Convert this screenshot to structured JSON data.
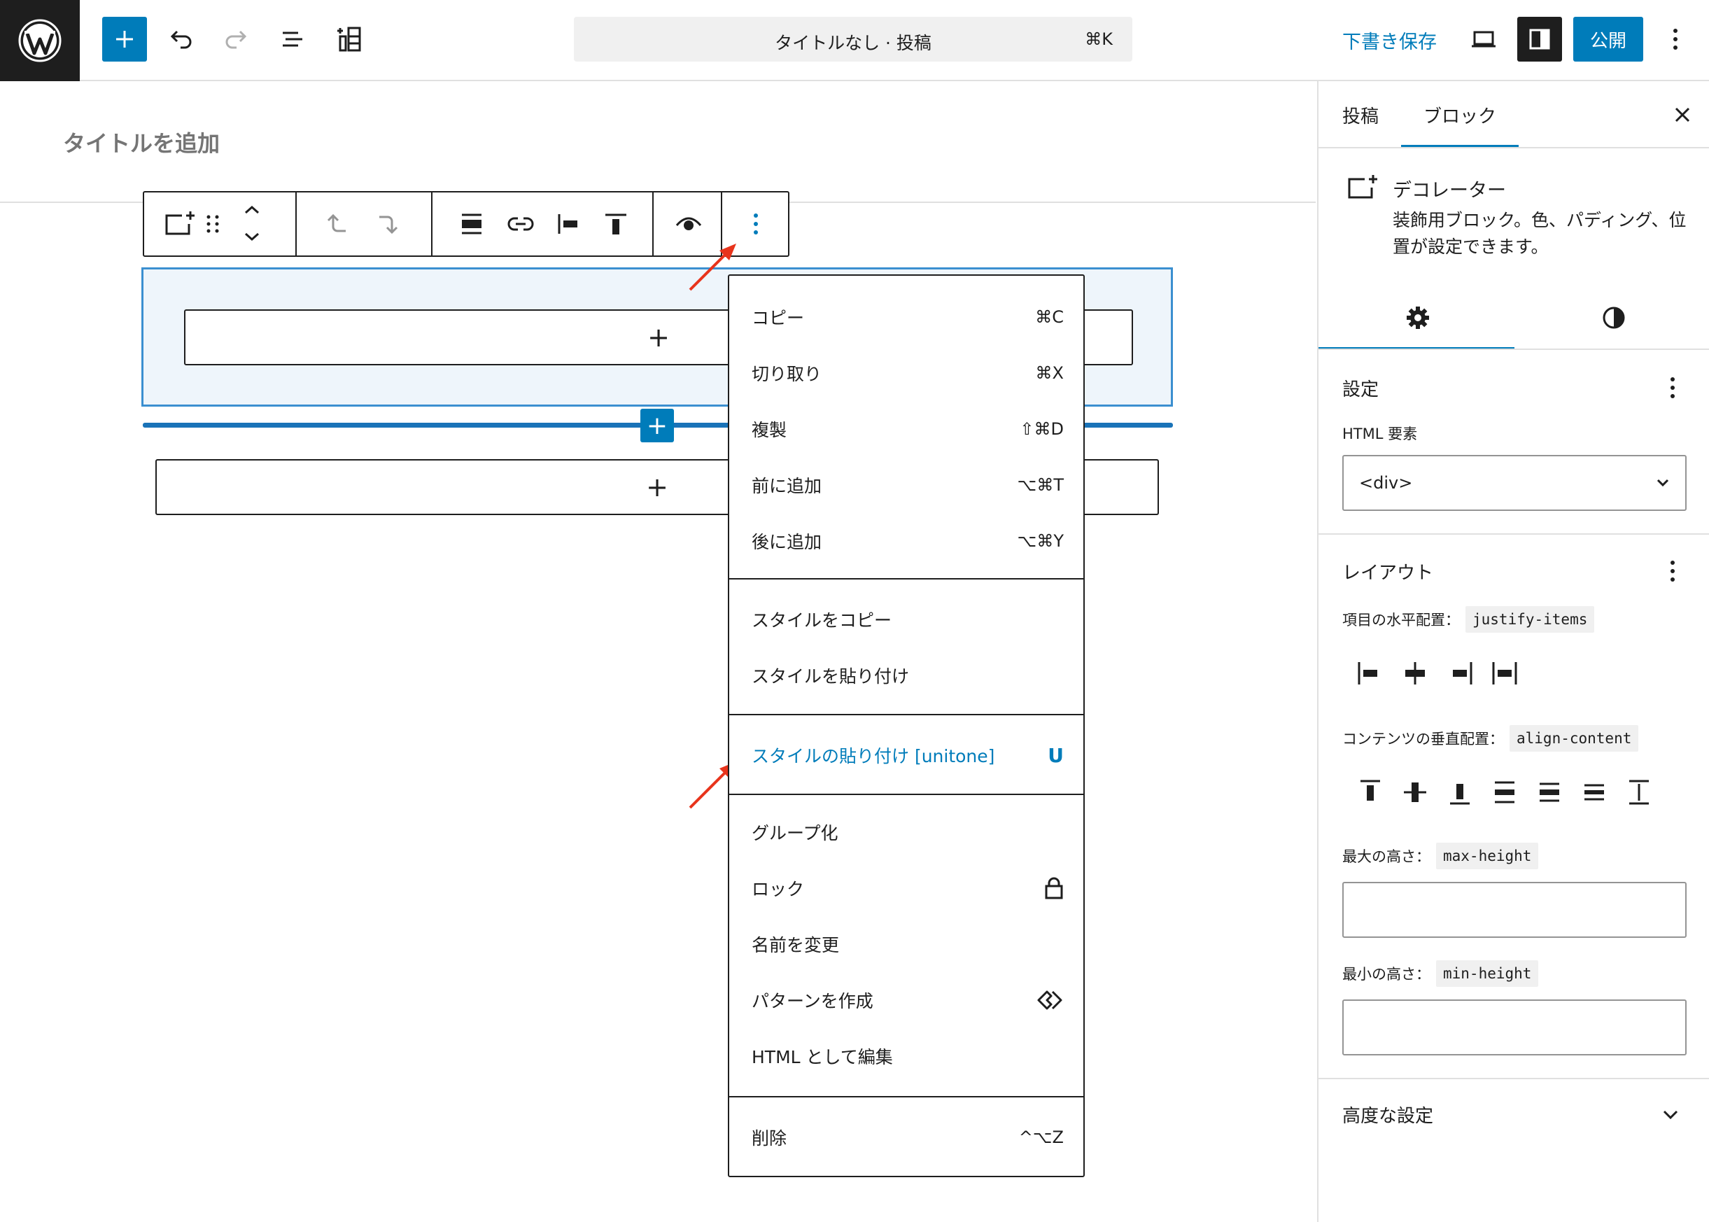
{
  "topbar": {
    "doc_title": "タイトルなし · 投稿",
    "doc_shortcut": "⌘K",
    "draft_save": "下書き保存",
    "publish": "公開"
  },
  "editor": {
    "title_placeholder": "タイトルを追加",
    "appender_glyph": "+",
    "inserter_glyph": "+"
  },
  "menu": {
    "groups": [
      [
        {
          "label": "コピー",
          "shortcut": "⌘C"
        },
        {
          "label": "切り取り",
          "shortcut": "⌘X"
        },
        {
          "label": "複製",
          "shortcut": "⇧⌘D"
        },
        {
          "label": "前に追加",
          "shortcut": "⌥⌘T"
        },
        {
          "label": "後に追加",
          "shortcut": "⌥⌘Y"
        }
      ],
      [
        {
          "label": "スタイルをコピー",
          "shortcut": ""
        },
        {
          "label": "スタイルを貼り付け",
          "shortcut": ""
        }
      ],
      [
        {
          "label": "スタイルの貼り付け [unitone]",
          "shortcut": "U"
        }
      ],
      [
        {
          "label": "グループ化",
          "shortcut": ""
        },
        {
          "label": "ロック",
          "shortcut": ""
        },
        {
          "label": "名前を変更",
          "shortcut": ""
        },
        {
          "label": "パターンを作成",
          "shortcut": ""
        },
        {
          "label": "HTML として編集",
          "shortcut": ""
        }
      ],
      [
        {
          "label": "削除",
          "shortcut": "^⌥Z"
        }
      ]
    ]
  },
  "sidebar": {
    "tabs": [
      "投稿",
      "ブロック"
    ],
    "active_tab": "ブロック",
    "block_name": "デコレーター",
    "block_desc": "装飾用ブロック。色、パディング、位置が設定できます。",
    "settings_heading": "設定",
    "html_element_label": "HTML 要素",
    "html_element_value": "<div>",
    "layout_heading": "レイアウト",
    "justify_label": "項目の水平配置：",
    "justify_code": "justify-items",
    "align_label": "コンテンツの垂直配置：",
    "align_code": "align-content",
    "max_height_label": "最大の高さ：",
    "max_height_code": "max-height",
    "min_height_label": "最小の高さ：",
    "min_height_code": "min-height",
    "advanced_heading": "高度な設定"
  },
  "colors": {
    "accent": "#007cba",
    "annotation_arrow": "#e8341c",
    "selection": "#eef5fb"
  }
}
